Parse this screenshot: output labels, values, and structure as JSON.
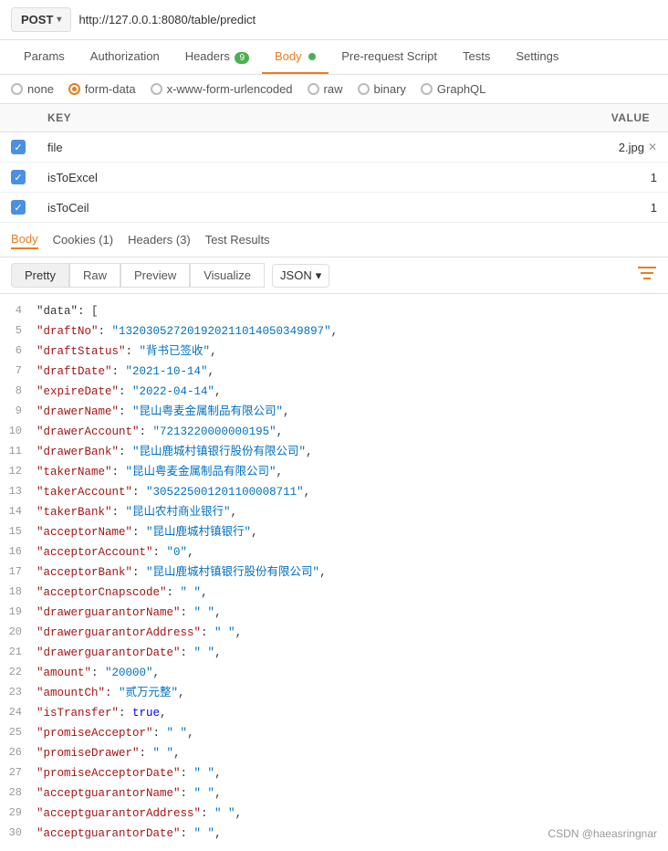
{
  "url_bar": {
    "method": "POST",
    "url": "http://127.0.0.1:8080/table/predict"
  },
  "main_tabs": [
    {
      "label": "Params",
      "active": false
    },
    {
      "label": "Authorization",
      "active": false
    },
    {
      "label": "Headers",
      "active": false,
      "badge": "9"
    },
    {
      "label": "Body",
      "active": true,
      "dot": true
    },
    {
      "label": "Pre-request Script",
      "active": false
    },
    {
      "label": "Tests",
      "active": false
    },
    {
      "label": "Settings",
      "active": false
    }
  ],
  "body_types": [
    {
      "label": "none",
      "selected": false
    },
    {
      "label": "form-data",
      "selected": true
    },
    {
      "label": "x-www-form-urlencoded",
      "selected": false
    },
    {
      "label": "raw",
      "selected": false
    },
    {
      "label": "binary",
      "selected": false
    },
    {
      "label": "GraphQL",
      "selected": false
    }
  ],
  "form_table": {
    "headers": [
      "KEY",
      "VALUE"
    ],
    "rows": [
      {
        "checked": true,
        "key": "file",
        "value": "2.jpg",
        "is_file": true
      },
      {
        "checked": true,
        "key": "isToExcel",
        "value": "1",
        "is_file": false
      },
      {
        "checked": true,
        "key": "isToCeil",
        "value": "1",
        "is_file": false
      }
    ]
  },
  "response_tabs": [
    {
      "label": "Body",
      "active": true
    },
    {
      "label": "Cookies (1)",
      "active": false
    },
    {
      "label": "Headers (3)",
      "active": false
    },
    {
      "label": "Test Results",
      "active": false
    }
  ],
  "view_buttons": [
    {
      "label": "Pretty",
      "active": true
    },
    {
      "label": "Raw",
      "active": false
    },
    {
      "label": "Preview",
      "active": false
    },
    {
      "label": "Visualize",
      "active": false
    }
  ],
  "format_select": "JSON",
  "code_lines": [
    {
      "num": 4,
      "content": [
        {
          "t": "p",
          "v": "    \"data\": ["
        }
      ]
    },
    {
      "num": 5,
      "content": [
        {
          "t": "p",
          "v": "        "
        },
        {
          "t": "k",
          "v": "\"draftNo\""
        },
        {
          "t": "p",
          "v": ": "
        },
        {
          "t": "s",
          "v": "\"132030527201920211014050349897\""
        },
        {
          "t": "p",
          "v": ","
        }
      ]
    },
    {
      "num": 6,
      "content": [
        {
          "t": "p",
          "v": "        "
        },
        {
          "t": "k",
          "v": "\"draftStatus\""
        },
        {
          "t": "p",
          "v": ": "
        },
        {
          "t": "s",
          "v": "\"背书已签收\""
        },
        {
          "t": "p",
          "v": ","
        }
      ]
    },
    {
      "num": 7,
      "content": [
        {
          "t": "p",
          "v": "        "
        },
        {
          "t": "k",
          "v": "\"draftDate\""
        },
        {
          "t": "p",
          "v": ": "
        },
        {
          "t": "s",
          "v": "\"2021-10-14\""
        },
        {
          "t": "p",
          "v": ","
        }
      ]
    },
    {
      "num": 8,
      "content": [
        {
          "t": "p",
          "v": "        "
        },
        {
          "t": "k",
          "v": "\"expireDate\""
        },
        {
          "t": "p",
          "v": ": "
        },
        {
          "t": "s",
          "v": "\"2022-04-14\""
        },
        {
          "t": "p",
          "v": ","
        }
      ]
    },
    {
      "num": 9,
      "content": [
        {
          "t": "p",
          "v": "        "
        },
        {
          "t": "k",
          "v": "\"drawerName\""
        },
        {
          "t": "p",
          "v": ": "
        },
        {
          "t": "s",
          "v": "\"昆山粤麦金属制品有限公司\""
        },
        {
          "t": "p",
          "v": ","
        }
      ]
    },
    {
      "num": 10,
      "content": [
        {
          "t": "p",
          "v": "        "
        },
        {
          "t": "k",
          "v": "\"drawerAccount\""
        },
        {
          "t": "p",
          "v": ": "
        },
        {
          "t": "s",
          "v": "\"7213220000000195\""
        },
        {
          "t": "p",
          "v": ","
        }
      ]
    },
    {
      "num": 11,
      "content": [
        {
          "t": "p",
          "v": "        "
        },
        {
          "t": "k",
          "v": "\"drawerBank\""
        },
        {
          "t": "p",
          "v": ": "
        },
        {
          "t": "s",
          "v": "\"昆山鹿城村镇银行股份有限公司\""
        },
        {
          "t": "p",
          "v": ","
        }
      ]
    },
    {
      "num": 12,
      "content": [
        {
          "t": "p",
          "v": "        "
        },
        {
          "t": "k",
          "v": "\"takerName\""
        },
        {
          "t": "p",
          "v": ": "
        },
        {
          "t": "s",
          "v": "\"昆山粤麦金属制品有限公司\""
        },
        {
          "t": "p",
          "v": ","
        }
      ]
    },
    {
      "num": 13,
      "content": [
        {
          "t": "p",
          "v": "        "
        },
        {
          "t": "k",
          "v": "\"takerAccount\""
        },
        {
          "t": "p",
          "v": ": "
        },
        {
          "t": "s",
          "v": "\"305225001201100008711\""
        },
        {
          "t": "p",
          "v": ","
        }
      ]
    },
    {
      "num": 14,
      "content": [
        {
          "t": "p",
          "v": "        "
        },
        {
          "t": "k",
          "v": "\"takerBank\""
        },
        {
          "t": "p",
          "v": ": "
        },
        {
          "t": "s",
          "v": "\"昆山农村商业银行\""
        },
        {
          "t": "p",
          "v": ","
        }
      ]
    },
    {
      "num": 15,
      "content": [
        {
          "t": "p",
          "v": "        "
        },
        {
          "t": "k",
          "v": "\"acceptorName\""
        },
        {
          "t": "p",
          "v": ": "
        },
        {
          "t": "s",
          "v": "\"昆山鹿城村镇银行\""
        },
        {
          "t": "p",
          "v": ","
        }
      ]
    },
    {
      "num": 16,
      "content": [
        {
          "t": "p",
          "v": "        "
        },
        {
          "t": "k",
          "v": "\"acceptorAccount\""
        },
        {
          "t": "p",
          "v": ": "
        },
        {
          "t": "s",
          "v": "\"0\""
        },
        {
          "t": "p",
          "v": ","
        }
      ]
    },
    {
      "num": 17,
      "content": [
        {
          "t": "p",
          "v": "        "
        },
        {
          "t": "k",
          "v": "\"acceptorBank\""
        },
        {
          "t": "p",
          "v": ": "
        },
        {
          "t": "s",
          "v": "\"昆山鹿城村镇银行股份有限公司\""
        },
        {
          "t": "p",
          "v": ","
        }
      ]
    },
    {
      "num": 18,
      "content": [
        {
          "t": "p",
          "v": "        "
        },
        {
          "t": "k",
          "v": "\"acceptorCnapscode\""
        },
        {
          "t": "p",
          "v": ": "
        },
        {
          "t": "s",
          "v": "\" \""
        },
        {
          "t": "p",
          "v": ","
        }
      ]
    },
    {
      "num": 19,
      "content": [
        {
          "t": "p",
          "v": "        "
        },
        {
          "t": "k",
          "v": "\"drawerguarantorName\""
        },
        {
          "t": "p",
          "v": ": "
        },
        {
          "t": "s",
          "v": "\" \""
        },
        {
          "t": "p",
          "v": ","
        }
      ]
    },
    {
      "num": 20,
      "content": [
        {
          "t": "p",
          "v": "        "
        },
        {
          "t": "k",
          "v": "\"drawerguarantorAddress\""
        },
        {
          "t": "p",
          "v": ": "
        },
        {
          "t": "s",
          "v": "\" \""
        },
        {
          "t": "p",
          "v": ","
        }
      ]
    },
    {
      "num": 21,
      "content": [
        {
          "t": "p",
          "v": "        "
        },
        {
          "t": "k",
          "v": "\"drawerguarantorDate\""
        },
        {
          "t": "p",
          "v": ": "
        },
        {
          "t": "s",
          "v": "\" \""
        },
        {
          "t": "p",
          "v": ","
        }
      ]
    },
    {
      "num": 22,
      "content": [
        {
          "t": "p",
          "v": "        "
        },
        {
          "t": "k",
          "v": "\"amount\""
        },
        {
          "t": "p",
          "v": ": "
        },
        {
          "t": "s",
          "v": "\"20000\""
        },
        {
          "t": "p",
          "v": ","
        }
      ]
    },
    {
      "num": 23,
      "content": [
        {
          "t": "p",
          "v": "        "
        },
        {
          "t": "k",
          "v": "\"amountCh\""
        },
        {
          "t": "p",
          "v": ": "
        },
        {
          "t": "s",
          "v": "\"贰万元整\""
        },
        {
          "t": "p",
          "v": ","
        }
      ]
    },
    {
      "num": 24,
      "content": [
        {
          "t": "p",
          "v": "        "
        },
        {
          "t": "k",
          "v": "\"isTransfer\""
        },
        {
          "t": "p",
          "v": ": "
        },
        {
          "t": "b",
          "v": "true"
        },
        {
          "t": "p",
          "v": ","
        }
      ]
    },
    {
      "num": 25,
      "content": [
        {
          "t": "p",
          "v": "        "
        },
        {
          "t": "k",
          "v": "\"promiseAcceptor\""
        },
        {
          "t": "p",
          "v": ": "
        },
        {
          "t": "s",
          "v": "\" \""
        },
        {
          "t": "p",
          "v": ","
        }
      ]
    },
    {
      "num": 26,
      "content": [
        {
          "t": "p",
          "v": "        "
        },
        {
          "t": "k",
          "v": "\"promiseDrawer\""
        },
        {
          "t": "p",
          "v": ": "
        },
        {
          "t": "s",
          "v": "\" \""
        },
        {
          "t": "p",
          "v": ","
        }
      ]
    },
    {
      "num": 27,
      "content": [
        {
          "t": "p",
          "v": "        "
        },
        {
          "t": "k",
          "v": "\"promiseAcceptorDate\""
        },
        {
          "t": "p",
          "v": ": "
        },
        {
          "t": "s",
          "v": "\" \""
        },
        {
          "t": "p",
          "v": ","
        }
      ]
    },
    {
      "num": 28,
      "content": [
        {
          "t": "p",
          "v": "        "
        },
        {
          "t": "k",
          "v": "\"acceptguarantorName\""
        },
        {
          "t": "p",
          "v": ": "
        },
        {
          "t": "s",
          "v": "\" \""
        },
        {
          "t": "p",
          "v": ","
        }
      ]
    },
    {
      "num": 29,
      "content": [
        {
          "t": "p",
          "v": "        "
        },
        {
          "t": "k",
          "v": "\"acceptguarantorAddress\""
        },
        {
          "t": "p",
          "v": ": "
        },
        {
          "t": "s",
          "v": "\" \""
        },
        {
          "t": "p",
          "v": ","
        }
      ]
    },
    {
      "num": 30,
      "content": [
        {
          "t": "p",
          "v": "        "
        },
        {
          "t": "k",
          "v": "\"acceptguarantorDate\""
        },
        {
          "t": "p",
          "v": ": "
        },
        {
          "t": "s",
          "v": "\" \""
        },
        {
          "t": "p",
          "v": ","
        }
      ]
    }
  ],
  "watermark": "CSDN @haeasringnar"
}
